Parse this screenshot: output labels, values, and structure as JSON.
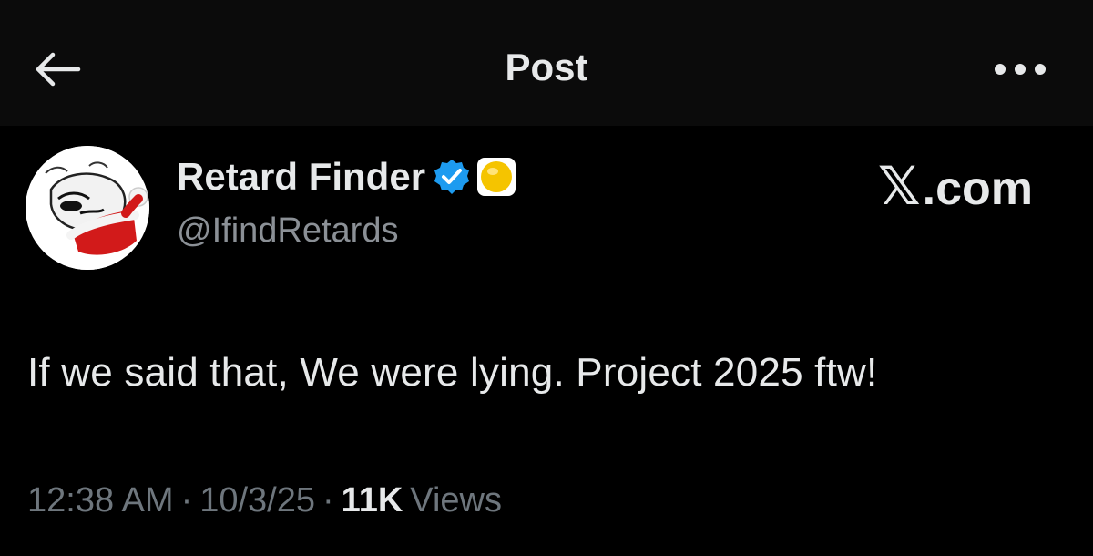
{
  "header": {
    "title": "Post",
    "back_icon": "arrow-left-icon",
    "more_icon": "more-horizontal-icon"
  },
  "author": {
    "display_name": "Retard Finder",
    "handle": "@IfindRetards",
    "verified_icon": "verified-badge-icon",
    "affiliate_icon": "yellow-circle-badge-icon",
    "avatar_icon": "avatar-santa-hat"
  },
  "brand": {
    "x_glyph": "𝕏",
    "suffix": ".com"
  },
  "post": {
    "text": "If we said that, We were lying. Project 2025 ftw!"
  },
  "meta": {
    "time": "12:38 AM",
    "date": "10/3/25",
    "views_count": "11K",
    "views_label": "Views",
    "separator": "·"
  },
  "colors": {
    "background": "#000000",
    "header_bg": "#0b0b0b",
    "text": "#e7e9ea",
    "muted": "#6e767d",
    "verified": "#1d9bf0"
  }
}
